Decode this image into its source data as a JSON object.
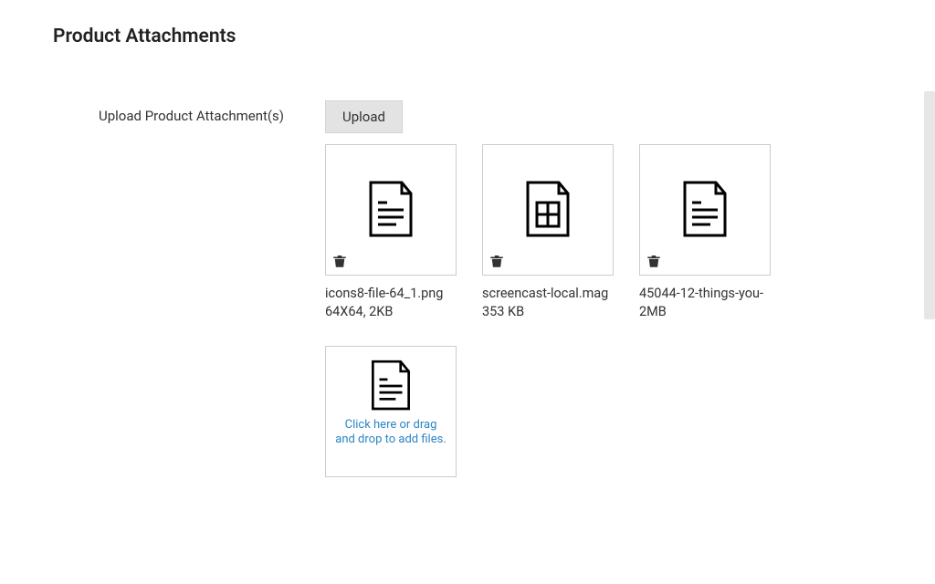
{
  "page": {
    "title": "Product Attachments",
    "field_label": "Upload Product Attachment(s)"
  },
  "upload": {
    "button_label": "Upload",
    "dropzone_text": "Click here or drag and drop to add files."
  },
  "attachments": [
    {
      "filename": "icons8-file-64_1.png",
      "meta": "64X64, 2KB",
      "icon": "doc-text"
    },
    {
      "filename": "screencast-local.mag",
      "meta": "353 KB",
      "icon": "doc-grid"
    },
    {
      "filename": "45044-12-things-you-",
      "meta": "2MB",
      "icon": "doc-text"
    }
  ]
}
